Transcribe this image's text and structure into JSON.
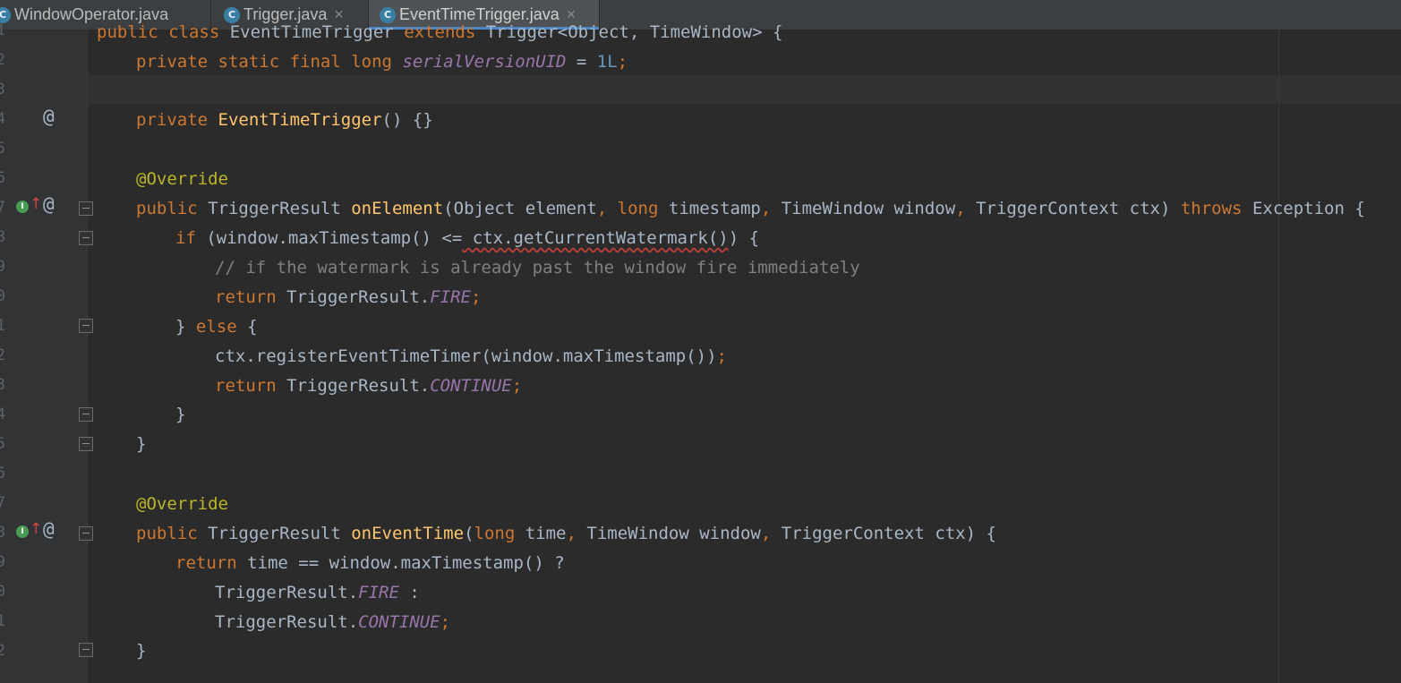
{
  "tabs": [
    {
      "name": "WindowOperator.java",
      "active": false
    },
    {
      "name": "Trigger.java",
      "active": false,
      "close": "×"
    },
    {
      "name": "EventTimeTrigger.java",
      "active": true,
      "close": "×"
    }
  ],
  "line_numbers": [
    "1",
    "2",
    "3",
    "4",
    "5",
    "6",
    "7",
    "8",
    "9",
    "0",
    "1",
    "2",
    "3",
    "4",
    "5",
    "6",
    "7",
    "8",
    "9",
    "0",
    "1",
    "2"
  ],
  "gutter_markers": {
    "at": "@",
    "impl": "I",
    "arrow": "↑"
  },
  "code": {
    "l1": {
      "a": "public class ",
      "b": "EventTimeTrigger ",
      "c": "extends ",
      "d": "Trigger<Object, TimeWindow> {"
    },
    "l2": {
      "a": "private static final long ",
      "b": "serialVersionUID",
      " c": "",
      "eq": " = ",
      "n": "1L",
      ";": ";"
    },
    "l4": {
      "a": "private ",
      "b": "EventTimeTrigger",
      "c": "() {}"
    },
    "l6": {
      "a": "@Override"
    },
    "l7": {
      "a": "public ",
      "b": "TriggerResult ",
      "c": "onElement",
      "d": "(Object element",
      ",": ", ",
      "e": "long ",
      "f": "timestamp",
      ",2": ", ",
      "g": "TimeWindow window",
      ",3": ", ",
      "h": "TriggerContext ctx) ",
      "i": "throws ",
      "j": "Exception {"
    },
    "l8": {
      "a": "if ",
      "b": "(window.maxTimestamp() <=",
      "c": " ctx.getCurrentWatermark()",
      "d": ") {"
    },
    "l9": {
      "a": "// if the watermark is already past the window fire immediately"
    },
    "l10": {
      "a": "return ",
      "b": "TriggerResult.",
      "c": "FIRE",
      ";": ";"
    },
    "l11": {
      "a": "} ",
      "b": "else ",
      "c": "{"
    },
    "l12": {
      "a": "ctx.registerEventTimeTimer(window.maxTimestamp())",
      ";": ";"
    },
    "l13": {
      "a": "return ",
      "b": "TriggerResult.",
      "c": "CONTINUE",
      ";": ";"
    },
    "l14": {
      "a": "}"
    },
    "l15": {
      "a": "}"
    },
    "l17": {
      "a": "@Override"
    },
    "l18": {
      "a": "public ",
      "b": "TriggerResult ",
      "c": "onEventTime",
      "d": "(",
      "e": "long ",
      "f": "time",
      ",": ", ",
      "g": "TimeWindow window",
      ",2": ", ",
      "h": "TriggerContext ctx) {"
    },
    "l19": {
      "a": "return ",
      "b": "time == window.maxTimestamp() ?"
    },
    "l20": {
      "a": "TriggerResult.",
      "b": "FIRE",
      " c": " :"
    },
    "l21": {
      "a": "TriggerResult.",
      "b": "CONTINUE",
      ";": ";"
    },
    "l22": {
      "a": "}"
    }
  },
  "colors": {
    "background": "#2B2B2B",
    "keyword": "#CC7832",
    "function": "#FFC66D",
    "annotation": "#BBB529",
    "number": "#6897BB",
    "comment": "#808080",
    "static": "#9876AA",
    "text": "#A9B7C6",
    "error_underline": "#BC3F3C"
  }
}
